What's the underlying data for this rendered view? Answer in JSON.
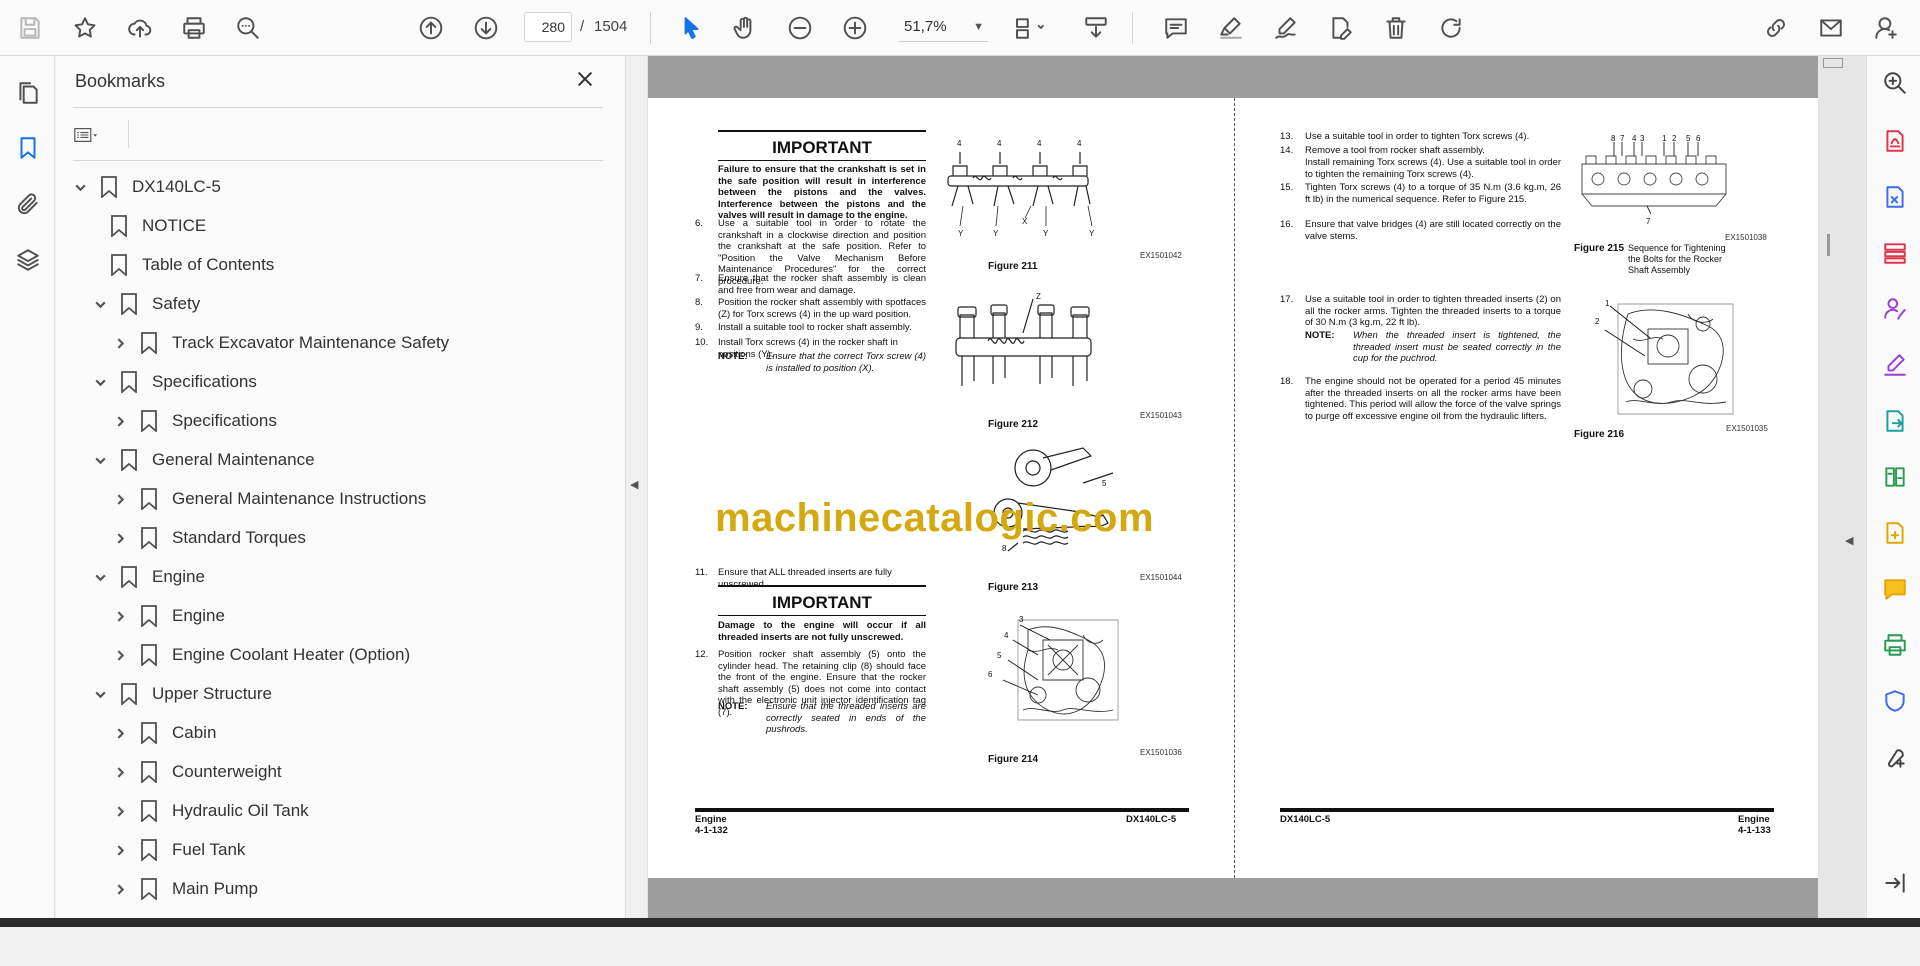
{
  "toolbar": {
    "current_page": "280",
    "page_separator": "/",
    "total_pages": "1504",
    "zoom": "51,7%",
    "icons": [
      "save-icon",
      "star-icon",
      "upload-icon",
      "print-icon",
      "search-zoom-icon",
      "page-up-icon",
      "page-down-icon",
      "select-cursor-icon",
      "hand-icon",
      "zoom-out-icon",
      "zoom-in-icon",
      "crop-icon",
      "scroll-mode-icon",
      "comment-icon",
      "highlight-icon",
      "sign-icon",
      "edit-icon",
      "delete-icon",
      "rotate-icon",
      "share-link-icon",
      "mail-icon",
      "user-add-icon"
    ]
  },
  "bookmarks": {
    "title": "Bookmarks",
    "items": [
      {
        "label": "DX140LC-5",
        "level": 0,
        "expanded": true
      },
      {
        "label": "NOTICE",
        "level": 1,
        "leaf": true
      },
      {
        "label": "Table of Contents",
        "level": 1,
        "leaf": true
      },
      {
        "label": "Safety",
        "level": 1,
        "expanded": true
      },
      {
        "label": "Track Excavator Maintenance Safety",
        "level": 2,
        "expanded": false
      },
      {
        "label": "Specifications",
        "level": 1,
        "expanded": true
      },
      {
        "label": "Specifications",
        "level": 2,
        "expanded": false
      },
      {
        "label": "General Maintenance",
        "level": 1,
        "expanded": true
      },
      {
        "label": "General Maintenance Instructions",
        "level": 2,
        "expanded": false
      },
      {
        "label": "Standard Torques",
        "level": 2,
        "expanded": false
      },
      {
        "label": "Engine",
        "level": 1,
        "expanded": true
      },
      {
        "label": "Engine",
        "level": 2,
        "expanded": false
      },
      {
        "label": "Engine Coolant Heater (Option)",
        "level": 2,
        "expanded": false
      },
      {
        "label": "Upper Structure",
        "level": 1,
        "expanded": true
      },
      {
        "label": "Cabin",
        "level": 2,
        "expanded": false
      },
      {
        "label": "Counterweight",
        "level": 2,
        "expanded": false
      },
      {
        "label": "Hydraulic Oil Tank",
        "level": 2,
        "expanded": false
      },
      {
        "label": "Fuel Tank",
        "level": 2,
        "expanded": false
      },
      {
        "label": "Main Pump",
        "level": 2,
        "expanded": false
      }
    ]
  },
  "doc": {
    "watermark": "machinecatalogic.com",
    "left": {
      "important1_title": "IMPORTANT",
      "important1_text": "Failure to ensure that the crankshaft is set in the safe position will result in interference between the pistons and the valves. Interference between the pistons and the valves will result in damage to the engine.",
      "step6_num": "6.",
      "step6": "Use a suitable tool in order to rotate the crankshaft in a clockwise direction and position the crankshaft at the safe position. Refer to \"Position the Valve Mechanism Before Maintenance Procedures\" for the correct procedure.",
      "step7_num": "7.",
      "step7": "Ensure that the rocker shaft assembly is clean and free from wear and damage.",
      "step8_num": "8.",
      "step8": "Position the rocker shaft assembly with spotfaces (Z) for Torx screws (4) in the up ward position.",
      "step9_num": "9.",
      "step9": "Install a suitable tool to rocker shaft assembly.",
      "step10_num": "10.",
      "step10": "Install Torx screws (4) in the rocker shaft in positions (Y).",
      "note_label": "NOTE:",
      "note10": "Ensure that the correct Torx screw (4) is installed to position (X).",
      "step11_num": "11.",
      "step11": "Ensure that ALL threaded inserts are fully unscrewed.",
      "important2_title": "IMPORTANT",
      "important2_text": "Damage to the engine will occur if all threaded inserts are not fully unscrewed.",
      "step12_num": "12.",
      "step12": "Position rocker shaft assembly (5) onto the cylinder head. The retaining clip (8) should face the front of the engine. Ensure that the rocker shaft assembly (5) does not come into contact with the electronic unit injector identification tag (7).",
      "note12": "Ensure that the threaded inserts are correctly seated in ends of the pushrods.",
      "fig211": "Figure 211",
      "fig211_id": "EX1501042",
      "fig211_labels": [
        "4",
        "4",
        "4",
        "4",
        "Y",
        "Y",
        "X",
        "Y",
        "Y"
      ],
      "fig212": "Figure 212",
      "fig212_id": "EX1501043",
      "fig212_label": "Z",
      "fig213": "Figure 213",
      "fig213_id": "EX1501044",
      "fig213_labels": [
        "5",
        "8"
      ],
      "fig214": "Figure 214",
      "fig214_id": "EX1501036",
      "fig214_labels": [
        "3",
        "4",
        "5",
        "6"
      ],
      "footer_left_section": "Engine",
      "footer_left_page": "4-1-132",
      "footer_right_model": "DX140LC-5"
    },
    "right": {
      "step13_num": "13.",
      "step13": "Use a suitable tool in order to tighten Torx screws (4).",
      "step14_num": "14.",
      "step14a": "Remove a tool from rocker shaft assembly.",
      "step14b": "Install remaining Torx screws (4). Use a suitable tool in order to tighten the remaining Torx screws (4).",
      "step15_num": "15.",
      "step15": "Tighten Torx screws (4) to a torque of 35 N.m (3.6 kg.m, 26 ft lb) in the numerical sequence. Refer to Figure 215.",
      "step16_num": "16.",
      "step16": "Ensure that valve bridges (4) are still located correctly on the valve stems.",
      "step17_num": "17.",
      "step17": "Use a suitable tool in order to tighten threaded inserts (2) on all the rocker arms. Tighten the threaded inserts to a torque of 30 N.m (3 kg.m, 22 ft lb).",
      "note_label": "NOTE:",
      "note17": "When the threaded insert is tightened, the threaded insert must be seated correctly in the cup for the puchrod.",
      "step18_num": "18.",
      "step18": "The engine should not be operated for a period 45 minutes after the threaded inserts on all the rocker arms have been tightened. This period will allow the force of the valve springs to purge off excessive engine oil from the hydraulic lifters.",
      "fig215": "Figure 215",
      "fig215_caption": "Sequence for Tightening the Bolts for the Rocker Shaft Assembly",
      "fig215_id": "EX1501038",
      "fig215_labels": [
        "8",
        "7",
        "4",
        "3",
        "1",
        "2",
        "5",
        "6",
        "7"
      ],
      "fig216": "Figure 216",
      "fig216_id": "EX1501035",
      "fig216_labels": [
        "1",
        "2"
      ],
      "footer_left_model": "DX140LC-5",
      "footer_right_section": "Engine",
      "footer_right_page": "4-1-133"
    }
  },
  "colors": {
    "accent": "#1473e6",
    "watermark": "#d4a90f",
    "right_rail_red": "#e0344a",
    "right_rail_blue": "#3d6ee8",
    "right_rail_purple": "#9a3fd6",
    "right_rail_green": "#2b9a54",
    "right_rail_teal": "#1aa0a0",
    "right_rail_yellow": "#e2a400"
  },
  "right_rail_icons": [
    "zoom-icon",
    "export-pdf-icon",
    "edit-pdf-icon",
    "organize-pages-icon",
    "request-signatures-icon",
    "fill-sign-icon",
    "export-icon",
    "compare-icon",
    "create-pdf-icon",
    "comment-tool-icon",
    "print-production-icon",
    "protect-icon",
    "more-tools-icon",
    "expand-icon"
  ]
}
